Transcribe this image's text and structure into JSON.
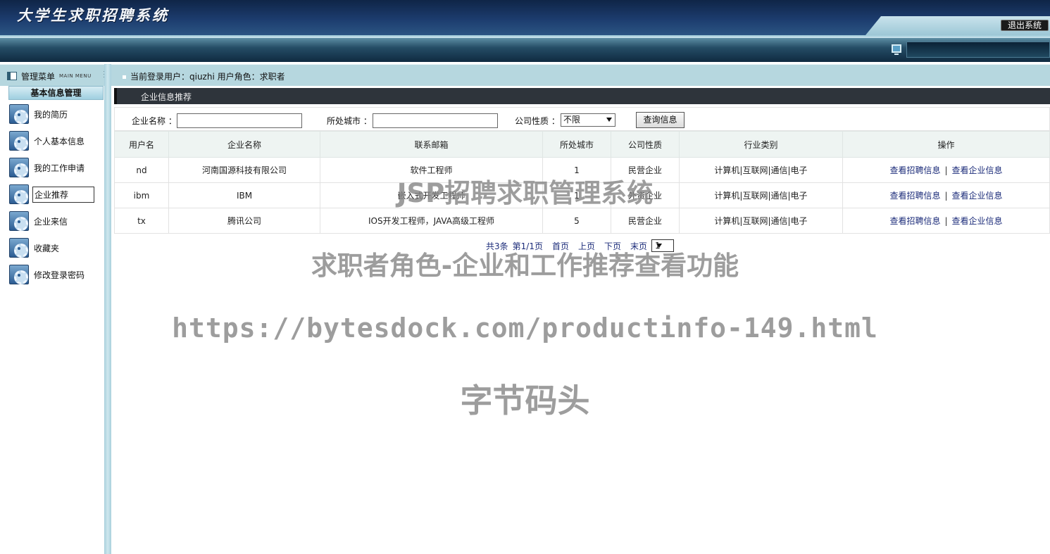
{
  "header": {
    "app_title": "大学生求职招聘系统",
    "logout_label": "退出系统"
  },
  "subbar": {
    "menu_title": "管理菜单",
    "menu_title_en": "MAIN MENU",
    "user_info": "当前登录用户：qiuzhi  用户角色：求职者"
  },
  "sidebar": {
    "section_title": "基本信息管理",
    "items": [
      {
        "label": "我的简历"
      },
      {
        "label": "个人基本信息"
      },
      {
        "label": "我的工作申请"
      },
      {
        "label": "企业推荐"
      },
      {
        "label": "企业来信"
      },
      {
        "label": "收藏夹"
      },
      {
        "label": "修改登录密码"
      }
    ],
    "active_item": "企业推荐"
  },
  "main": {
    "section_title": "企业信息推荐",
    "filters": {
      "company_name_label": "企业名称 ：",
      "company_name_value": "",
      "city_label": "所处城市 ：",
      "city_value": "",
      "type_label": "公司性质 ：",
      "type_value": "不限",
      "query_button": "查询信息"
    },
    "table": {
      "columns": [
        "用户名",
        "企业名称",
        "联系邮箱",
        "所处城市",
        "公司性质",
        "行业类别",
        "操作"
      ],
      "rows": [
        [
          "nd",
          "河南国源科技有限公司",
          "软件工程师",
          "1",
          "民营企业",
          "计算机|互联网|通信|电子"
        ],
        [
          "ibm",
          "IBM",
          "嵌入式开发工程师",
          "1",
          "外资企业",
          "计算机|互联网|通信|电子"
        ],
        [
          "tx",
          "腾讯公司",
          "IOS开发工程师，JAVA高级工程师",
          "5",
          "民营企业",
          "计算机|互联网|通信|电子"
        ]
      ],
      "action_jobs": "查看招聘信息",
      "action_separator": "|",
      "action_company": "查看企业信息"
    },
    "pager": {
      "count": "共3条",
      "page": "第1/1页",
      "first": "首页",
      "prev": "上页",
      "next": "下页",
      "last": "末页",
      "current_page": "1"
    }
  },
  "watermarks": {
    "line1": "JSP招聘求职管理系统",
    "line2": "求职者角色-企业和工作推荐查看功能",
    "line3": "https://bytesdock.com/productinfo-149.html",
    "line4": "字节码头"
  }
}
